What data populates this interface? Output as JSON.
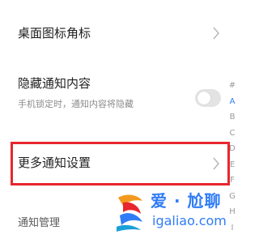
{
  "settings": {
    "items": [
      {
        "title": "桌面图标角标"
      },
      {
        "title": "隐藏通知内容",
        "subtitle": "手机锁定时，通知内容将隐藏",
        "toggle_on": false
      },
      {
        "title": "更多通知设置"
      },
      {
        "title": "通知管理"
      }
    ]
  },
  "alphabet_index": [
    "#",
    "A",
    "B",
    "C",
    "D",
    "E",
    "F",
    "G",
    "H",
    "I"
  ],
  "alphabet_active": "A",
  "highlight_color": "#e8262d",
  "watermark": {
    "text": "爱 · 尬聊",
    "url": "igaliao.com",
    "color": "#2f7cf6"
  }
}
